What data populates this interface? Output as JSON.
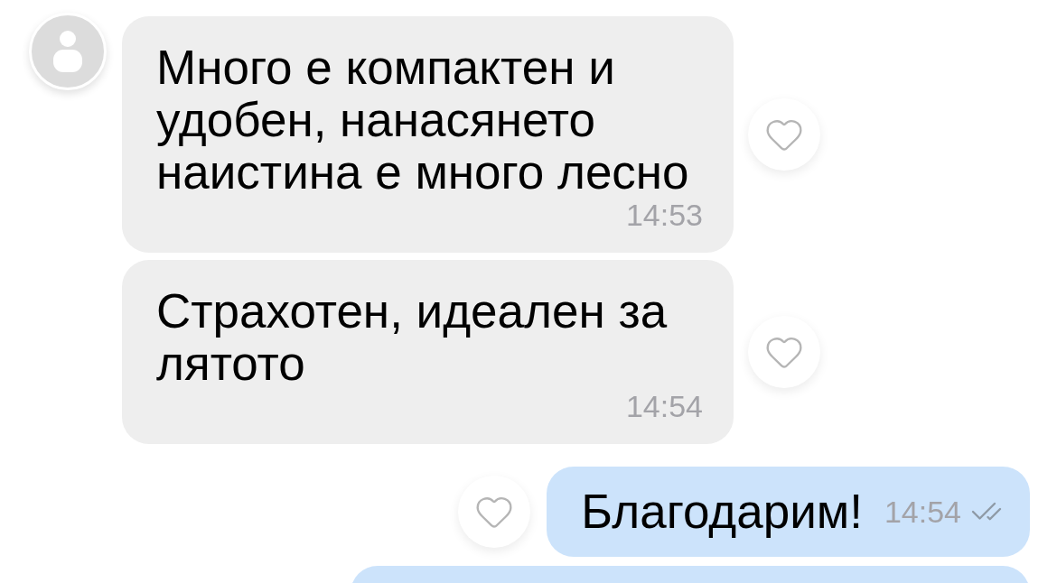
{
  "messages": [
    {
      "kind": "incoming",
      "avatar": true,
      "text": "Много е компактен и\nудобен, нанасянето\nнаистина е много лесно",
      "time": "14:53",
      "liked": false
    },
    {
      "kind": "incoming",
      "text": "Страхотен, идеален за\nлятото",
      "time": "14:54",
      "liked": false
    },
    {
      "kind": "outgoing",
      "text": "Благодарим!",
      "time": "14:54",
      "liked": false,
      "read": true
    },
    {
      "kind": "partial"
    }
  ]
}
